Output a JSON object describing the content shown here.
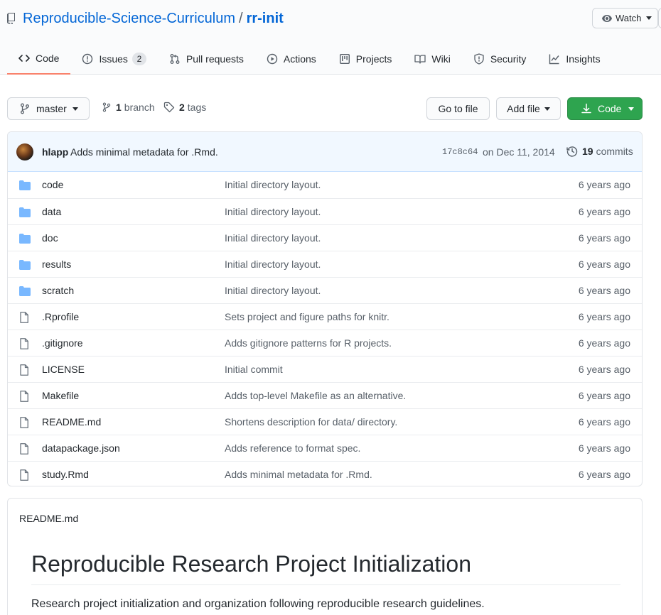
{
  "repo": {
    "owner": "Reproducible-Science-Curriculum",
    "separator": "/",
    "name": "rr-init"
  },
  "watch": {
    "label": "Watch"
  },
  "tabs": [
    {
      "label": "Code",
      "icon": "code-icon",
      "selected": true
    },
    {
      "label": "Issues",
      "icon": "issue-icon",
      "count": "2"
    },
    {
      "label": "Pull requests",
      "icon": "pull-request-icon"
    },
    {
      "label": "Actions",
      "icon": "play-icon"
    },
    {
      "label": "Projects",
      "icon": "project-icon"
    },
    {
      "label": "Wiki",
      "icon": "book-icon"
    },
    {
      "label": "Security",
      "icon": "shield-icon"
    },
    {
      "label": "Insights",
      "icon": "graph-icon"
    }
  ],
  "filenav": {
    "branch": "master",
    "branches_count": "1",
    "branches_label": "branch",
    "tags_count": "2",
    "tags_label": "tags",
    "goto_file": "Go to file",
    "add_file": "Add file",
    "code": "Code"
  },
  "latest_commit": {
    "author": "hlapp",
    "message": "Adds minimal metadata for .Rmd.",
    "sha": "17c8c64",
    "date": "on Dec 11, 2014",
    "commits_count": "19",
    "commits_label": "commits"
  },
  "files": [
    {
      "type": "dir",
      "name": "code",
      "message": "Initial directory layout.",
      "age": "6 years ago"
    },
    {
      "type": "dir",
      "name": "data",
      "message": "Initial directory layout.",
      "age": "6 years ago"
    },
    {
      "type": "dir",
      "name": "doc",
      "message": "Initial directory layout.",
      "age": "6 years ago"
    },
    {
      "type": "dir",
      "name": "results",
      "message": "Initial directory layout.",
      "age": "6 years ago"
    },
    {
      "type": "dir",
      "name": "scratch",
      "message": "Initial directory layout.",
      "age": "6 years ago"
    },
    {
      "type": "file",
      "name": ".Rprofile",
      "message": "Sets project and figure paths for knitr.",
      "age": "6 years ago"
    },
    {
      "type": "file",
      "name": ".gitignore",
      "message": "Adds gitignore patterns for R projects.",
      "age": "6 years ago"
    },
    {
      "type": "file",
      "name": "LICENSE",
      "message": "Initial commit",
      "age": "6 years ago"
    },
    {
      "type": "file",
      "name": "Makefile",
      "message": "Adds top-level Makefile as an alternative.",
      "age": "6 years ago"
    },
    {
      "type": "file",
      "name": "README.md",
      "message": "Shortens description for data/ directory.",
      "age": "6 years ago"
    },
    {
      "type": "file",
      "name": "datapackage.json",
      "message": "Adds reference to format spec.",
      "age": "6 years ago"
    },
    {
      "type": "file",
      "name": "study.Rmd",
      "message": "Adds minimal metadata for .Rmd.",
      "age": "6 years ago"
    }
  ],
  "readme": {
    "filename": "README.md",
    "title": "Reproducible Research Project Initialization",
    "body": "Research project initialization and organization following reproducible research guidelines."
  },
  "colors": {
    "link": "#0366d6",
    "folder": "#79b8ff",
    "primary_button": "#2ea44f",
    "selected_tab_underline": "#f9826c"
  }
}
